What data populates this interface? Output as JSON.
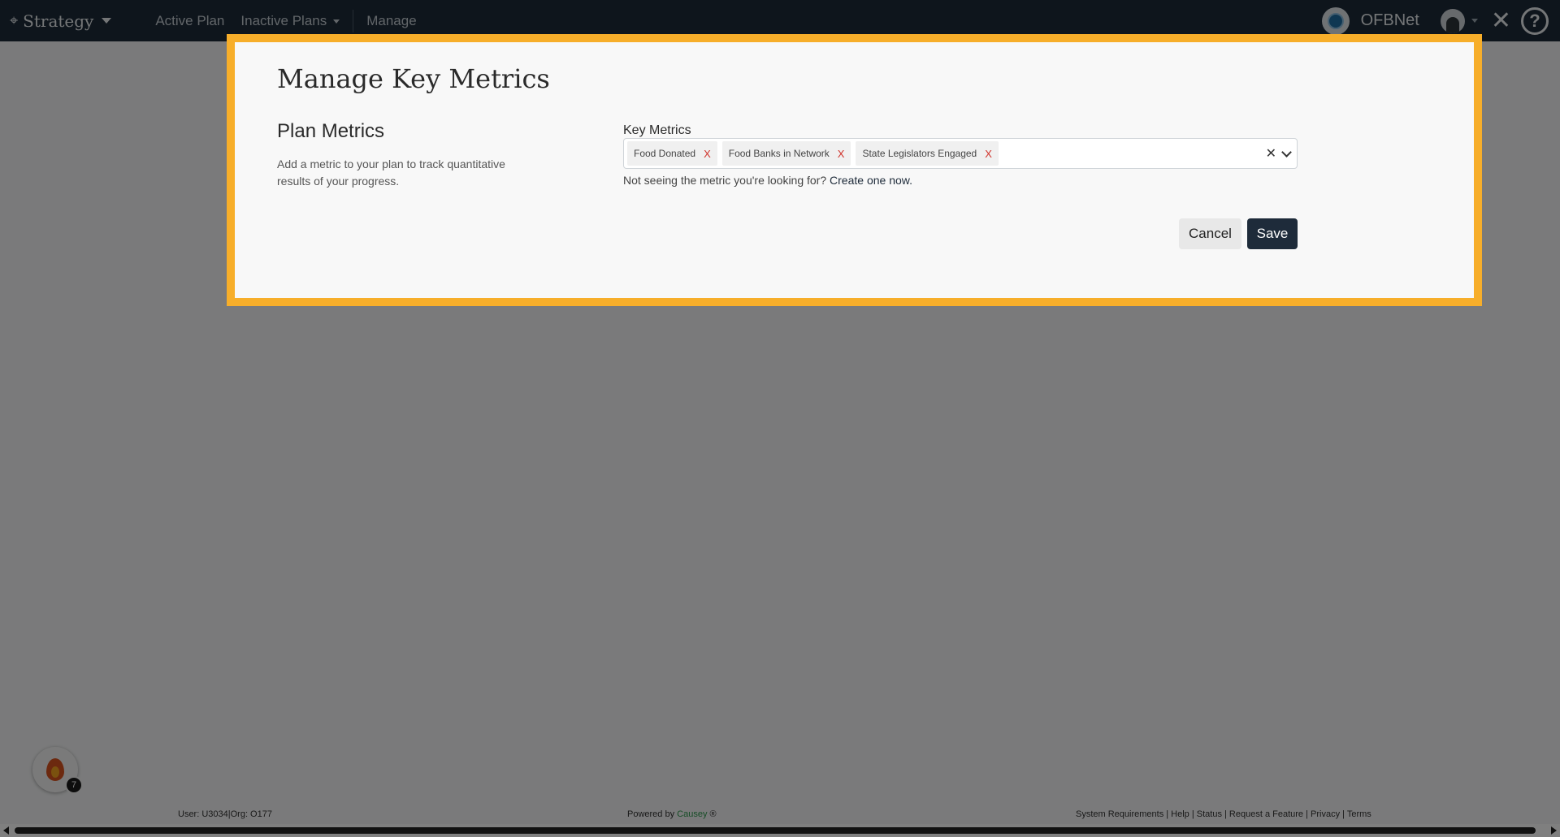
{
  "navbar": {
    "brand": "Strategy",
    "links": [
      "Active Plan",
      "Inactive Plans",
      "Manage"
    ],
    "org_name": "OFBNet"
  },
  "modal": {
    "title": "Manage Key Metrics",
    "section_title": "Plan Metrics",
    "section_description": "Add a metric to your plan to track quantitative results of your progress.",
    "field_label": "Key Metrics",
    "selected_metrics": [
      "Food Donated",
      "Food Banks in Network",
      "State Legislators Engaged"
    ],
    "remove_label": "X",
    "help_text": "Not seeing the metric you're looking for?",
    "help_link": "Create one now.",
    "cancel_label": "Cancel",
    "save_label": "Save"
  },
  "footer": {
    "user_info": "User: U3034|Org: O177",
    "powered_by": "Powered by",
    "brand": "Causey",
    "brand_mark": "®",
    "links": "System Requirements | Help | Status | Request a Feature | Privacy | Terms"
  },
  "notification_count": "7",
  "colors": {
    "navbar_bg": "#1c2a39",
    "modal_border": "#f7ae2a",
    "save_button": "#1e2b3a",
    "remove_x": "#d0342c",
    "causey_link": "#2e9b4f"
  }
}
